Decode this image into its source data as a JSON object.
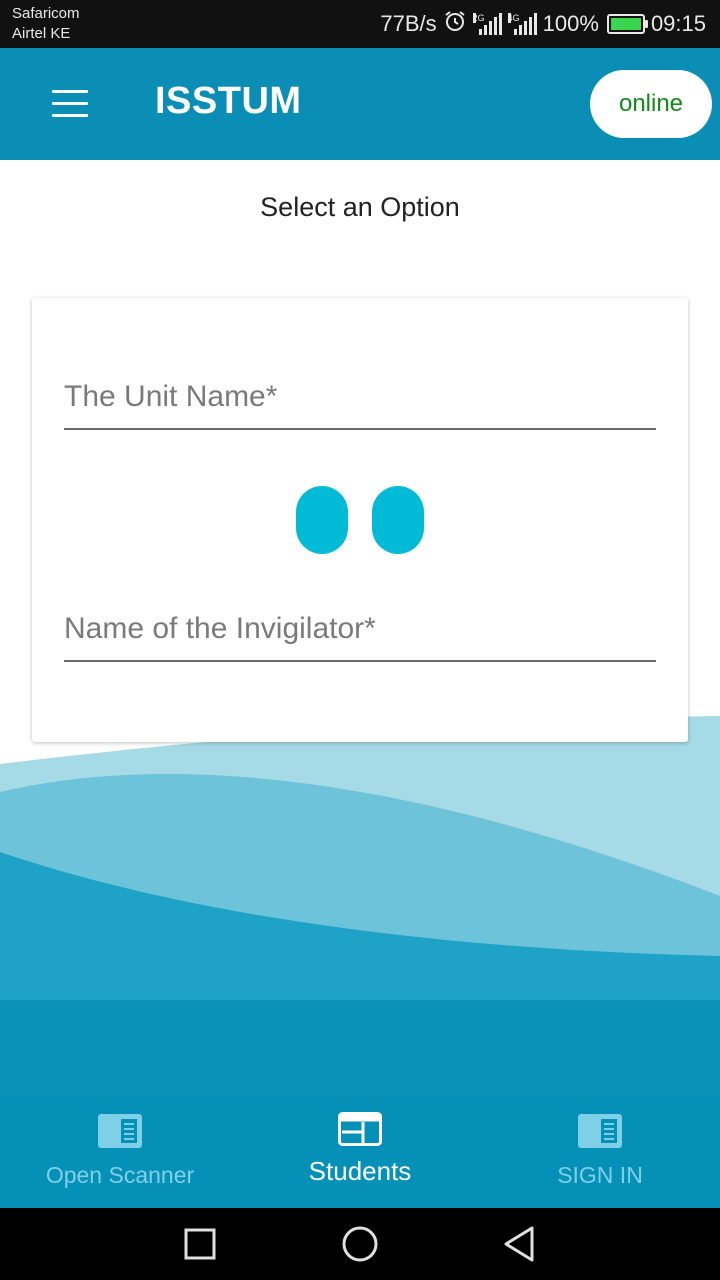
{
  "status_bar": {
    "carrier_1": "Safaricom",
    "carrier_2": "Airtel KE",
    "net_speed": "77B/s",
    "signal_1_tag": "2G",
    "signal_2_tag": "4G",
    "battery_percent": "100%",
    "battery_level": 1.0,
    "time": "09:15"
  },
  "app_bar": {
    "title": "ISSTUM",
    "status_pill": "online",
    "status_color": "#128a1a",
    "bar_color": "#0a8eb5"
  },
  "main": {
    "heading": "Select an Option",
    "form": {
      "unit_name_placeholder": "The Unit Name*",
      "invigilator_placeholder": "Name of the Invigilator*",
      "loader_color": "#00bad6"
    }
  },
  "bottom_nav": {
    "items": [
      {
        "label": "Open Scanner",
        "icon": "scanner-icon",
        "active": false
      },
      {
        "label": "Students",
        "icon": "students-icon",
        "active": true
      },
      {
        "label": "SIGN IN",
        "icon": "sign-in-icon",
        "active": false
      }
    ]
  },
  "system_nav": {
    "recent": "square-icon",
    "home": "circle-icon",
    "back": "triangle-back-icon"
  }
}
